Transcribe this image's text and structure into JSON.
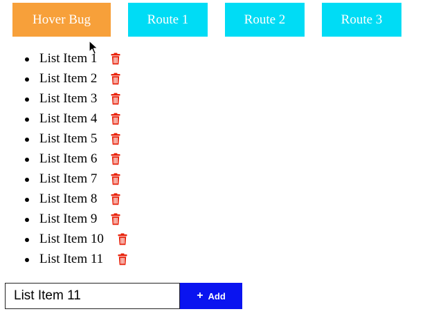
{
  "colors": {
    "hover_bug_bg": "#f7a03a",
    "route_bg": "#00dcf5",
    "trash": "#e8230c",
    "add_button_bg": "#0a14f0"
  },
  "nav": {
    "buttons": [
      {
        "label": "Hover Bug"
      },
      {
        "label": "Route 1"
      },
      {
        "label": "Route 2"
      },
      {
        "label": "Route 3"
      }
    ]
  },
  "list": {
    "items": [
      {
        "label": "List Item 1",
        "icon": "trash-icon"
      },
      {
        "label": "List Item 2",
        "icon": "trash-icon"
      },
      {
        "label": "List Item 3",
        "icon": "trash-icon"
      },
      {
        "label": "List Item 4",
        "icon": "trash-icon"
      },
      {
        "label": "List Item 5",
        "icon": "trash-icon"
      },
      {
        "label": "List Item 6",
        "icon": "trash-icon"
      },
      {
        "label": "List Item 7",
        "icon": "trash-icon"
      },
      {
        "label": "List Item 8",
        "icon": "trash-icon"
      },
      {
        "label": "List Item 9",
        "icon": "trash-icon"
      },
      {
        "label": "List Item 10",
        "icon": "trash-icon"
      },
      {
        "label": "List Item 11",
        "icon": "trash-icon"
      }
    ]
  },
  "form": {
    "input_value": "List Item 11",
    "add_label": "Add",
    "add_icon": "plus-icon"
  }
}
